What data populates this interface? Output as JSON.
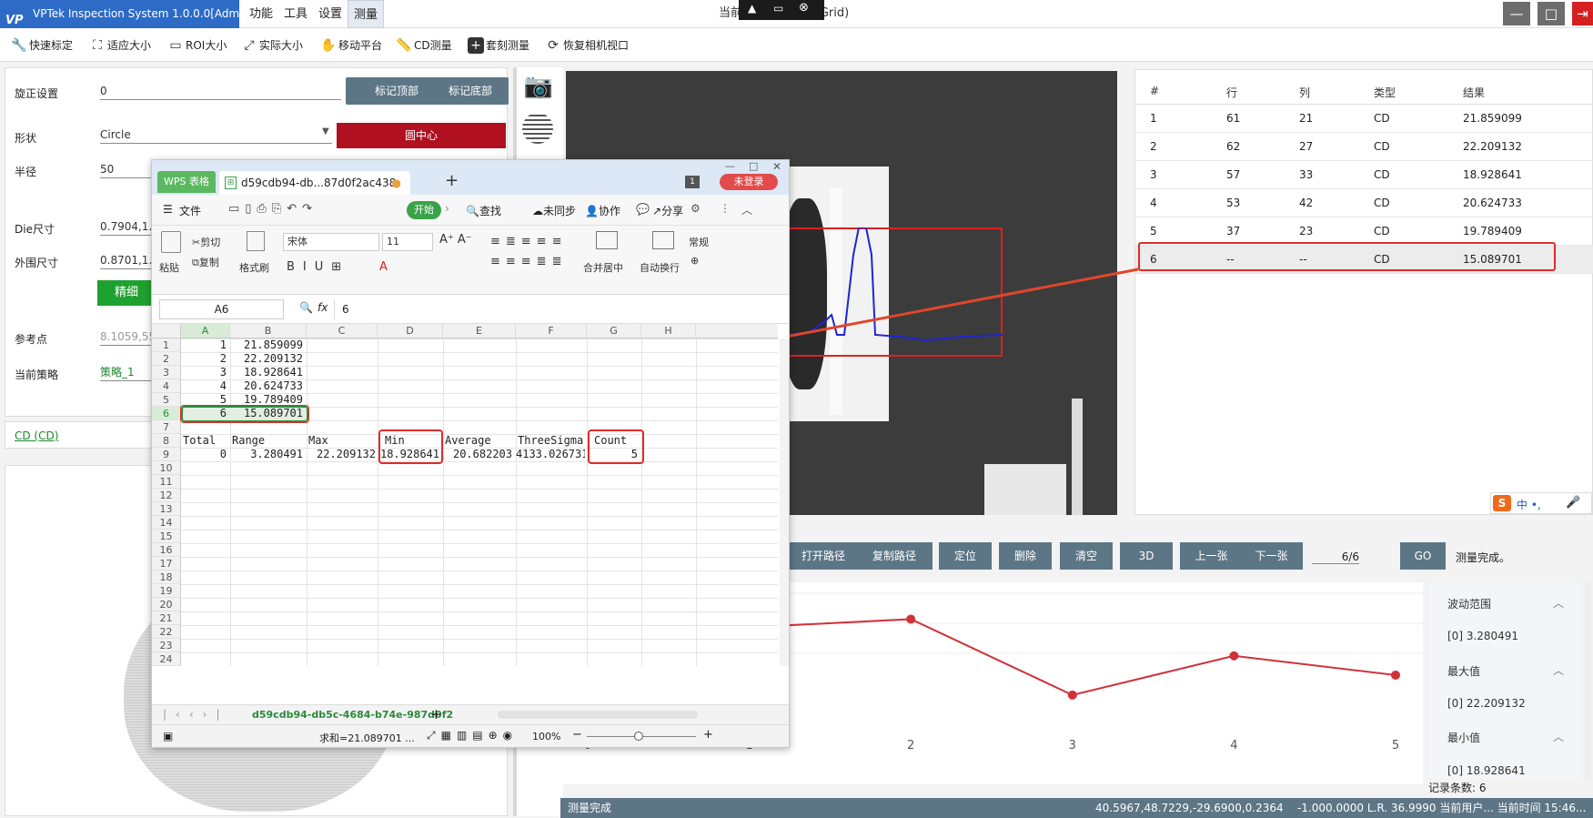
{
  "app": {
    "logo": "VP",
    "title": "VPTek Inspection System 1.0.0.0[Admin]",
    "window_title": "当前... ...c_0415 (Grid)",
    "menus": [
      "功能",
      "工具",
      "设置",
      "测量"
    ],
    "active_menu": "测量"
  },
  "toolbar": {
    "items": [
      "快速标定",
      "适应大小",
      "ROI大小",
      "实际大小",
      "移动平台",
      "CD测量",
      "套刻测量",
      "恢复相机视口"
    ]
  },
  "left": {
    "rotate_label": "旋正设置",
    "rotate_value": "0",
    "mark_top": "标记顶部",
    "mark_bottom": "标记底部",
    "shape_label": "形状",
    "shape_value": "Circle",
    "circle_center": "圆中心",
    "radius_label": "半径",
    "radius_value": "50",
    "die_label": "Die尺寸",
    "die_value": "0.7904,1.19",
    "outer_label": "外围尺寸",
    "outer_value": "0.8701,1.26",
    "green_btn": "精细",
    "ref_label": "参考点",
    "ref_value": "8.1059,55.4",
    "strategy_label": "当前策略",
    "strategy_value": "策略_1",
    "cd_link": "CD (CD)"
  },
  "table": {
    "headers": [
      "#",
      "行",
      "列",
      "类型",
      "结果"
    ],
    "rows": [
      [
        "1",
        "61",
        "21",
        "CD",
        "21.859099"
      ],
      [
        "2",
        "62",
        "27",
        "CD",
        "22.209132"
      ],
      [
        "3",
        "57",
        "33",
        "CD",
        "18.928641"
      ],
      [
        "4",
        "53",
        "42",
        "CD",
        "20.624733"
      ],
      [
        "5",
        "37",
        "23",
        "CD",
        "19.789409"
      ],
      [
        "6",
        "--",
        "--",
        "CD",
        "15.089701"
      ]
    ]
  },
  "buttons": {
    "open_path": "打开路径",
    "copy_path": "复制路径",
    "locate": "定位",
    "delete": "删除",
    "clear": "清空",
    "three_d": "3D",
    "prev": "上一张",
    "next": "下一张",
    "page": "6/6",
    "go": "GO",
    "status_msg": "测量完成。"
  },
  "stats": {
    "range_title": "波动范围",
    "range_value": "[0]   3.280491",
    "max_title": "最大值",
    "max_value": "[0]   22.209132",
    "min_title": "最小值",
    "min_value": "[0]   18.928641",
    "record_count": "记录条数: 6"
  },
  "statusbar": {
    "left": "测量完成",
    "coords": "40.5967,48.7229,-29.6900,0.2364",
    "extra": "-1.000.0000   L.R.     36.9990   当前用户...   当前时间   15:46..."
  },
  "ime": {
    "label": "中 •,"
  },
  "chart_data": {
    "type": "line",
    "x": [
      1,
      2,
      3,
      4,
      5
    ],
    "values": [
      21.859099,
      22.209132,
      18.928641,
      20.624733,
      19.789409
    ],
    "xticks": [
      "0",
      "1",
      "2",
      "3",
      "4",
      "5"
    ],
    "xlim": [
      0,
      5
    ],
    "ylim": [
      17.9,
      23.8
    ],
    "color": "#d0323a",
    "grid": true
  },
  "wps": {
    "app_tab": "WPS 表格",
    "doc_tab": "d59cdb94-db...87d0f2ac438",
    "plus": "+",
    "badge": "1",
    "login": "未登录",
    "menu_file": "文件",
    "menu_start": "开始",
    "find": "查找",
    "sync": "未同步",
    "collab": "协作",
    "share": "分享",
    "ribbon": {
      "paste": "粘贴",
      "cut": "剪切",
      "copy": "复制",
      "format_painter": "格式刷",
      "font": "宋体",
      "size": "11",
      "merge": "合并居中",
      "wrap": "自动换行",
      "normal": "常规"
    },
    "namebox": "A6",
    "fx": "fx",
    "formula": "6",
    "columns": [
      "A",
      "B",
      "C",
      "D",
      "E",
      "F",
      "G",
      "H"
    ],
    "rownums": [
      "1",
      "2",
      "3",
      "4",
      "5",
      "6",
      "7",
      "8",
      "9",
      "10",
      "11",
      "12",
      "13",
      "14",
      "15",
      "16",
      "17",
      "18",
      "19",
      "20",
      "21",
      "22",
      "23",
      "24"
    ],
    "cells": {
      "a1": "1",
      "b1": "21.859099",
      "a2": "2",
      "b2": "22.209132",
      "a3": "3",
      "b3": "18.928641",
      "a4": "4",
      "b4": "20.624733",
      "a5": "5",
      "b5": "19.789409",
      "a6": "6",
      "b6": "15.089701",
      "a8": "Total",
      "b8": "Range",
      "c8": "Max",
      "d8": "Min",
      "e8": "Average",
      "f8": "ThreeSigma",
      "g8": "Count",
      "a9": "0",
      "b9": "3.280491",
      "c9": "22.209132",
      "d9": "18.928641",
      "e9": "20.682203",
      "f9": "4133.026731",
      "g9": "5"
    },
    "sheet_tab": "d59cdb94-db5c-4684-b74e-987d0f2",
    "sum": "求和=21.089701  ...",
    "zoom": "100%"
  }
}
